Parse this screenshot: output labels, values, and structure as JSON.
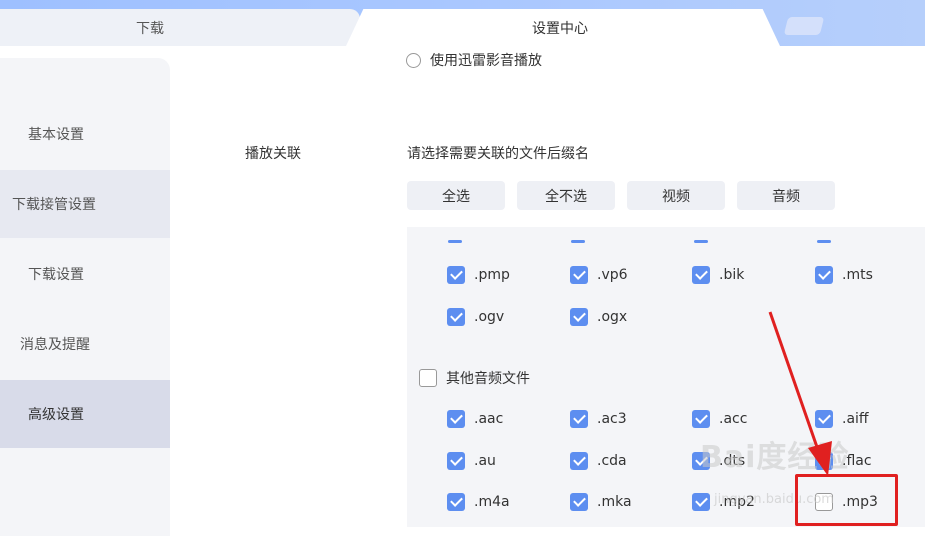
{
  "tabs": [
    {
      "label": "下载",
      "active": false
    },
    {
      "label": "设置中心",
      "active": true
    }
  ],
  "sidebar": {
    "items": [
      {
        "label": "基本设置"
      },
      {
        "label": "下载接管设置"
      },
      {
        "label": "下载设置"
      },
      {
        "label": "消息及提醒"
      },
      {
        "label": "高级设置",
        "active": true
      }
    ]
  },
  "content": {
    "radio_label": "使用迅雷影音播放",
    "section_label": "播放关联",
    "hint": "请选择需要关联的文件后缀名",
    "buttons": [
      "全选",
      "全不选",
      "视频",
      "音频"
    ],
    "video_exts": [
      {
        "label": ".pmp",
        "checked": true
      },
      {
        "label": ".vp6",
        "checked": true
      },
      {
        "label": ".bik",
        "checked": true
      },
      {
        "label": ".mts",
        "checked": true
      },
      {
        "label": ".ogv",
        "checked": true
      },
      {
        "label": ".ogx",
        "checked": true
      }
    ],
    "audio_group": {
      "label": "其他音频文件",
      "checked": false
    },
    "audio_exts": [
      {
        "label": ".aac",
        "checked": true
      },
      {
        "label": ".ac3",
        "checked": true
      },
      {
        "label": ".acc",
        "checked": true
      },
      {
        "label": ".aiff",
        "checked": true
      },
      {
        "label": ".au",
        "checked": true
      },
      {
        "label": ".cda",
        "checked": true
      },
      {
        "label": ".dts",
        "checked": true
      },
      {
        "label": ".flac",
        "checked": true
      },
      {
        "label": ".m4a",
        "checked": true
      },
      {
        "label": ".mka",
        "checked": true
      },
      {
        "label": ".mp2",
        "checked": true
      },
      {
        "label": ".mp3",
        "checked": false
      }
    ]
  },
  "colors": {
    "accent": "#5d8ef0",
    "annotation": "#e02020"
  },
  "watermark": {
    "text": "Bai度经验",
    "sub": "jingyan.baidu.com"
  }
}
